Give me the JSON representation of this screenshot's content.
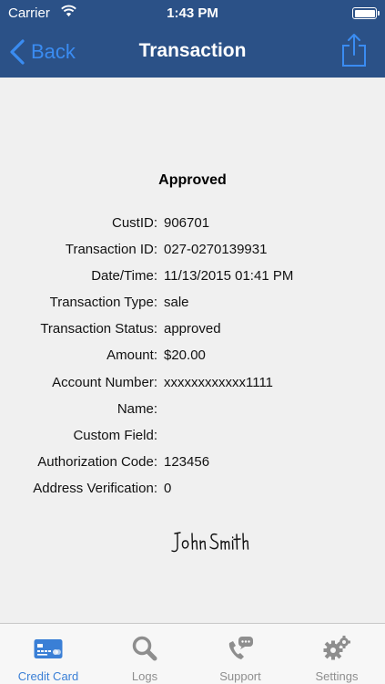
{
  "status_bar": {
    "carrier": "Carrier",
    "time": "1:43 PM"
  },
  "nav": {
    "back_label": "Back",
    "title": "Transaction"
  },
  "transaction": {
    "status": "Approved",
    "fields": [
      {
        "label": "CustID:",
        "value": "906701"
      },
      {
        "label": "Transaction ID:",
        "value": "027-0270139931"
      },
      {
        "label": "Date/Time:",
        "value": "11/13/2015 01:41 PM"
      },
      {
        "label": "Transaction Type:",
        "value": "sale"
      },
      {
        "label": "Transaction Status:",
        "value": "approved"
      },
      {
        "label": "Amount:",
        "value": "$20.00"
      },
      {
        "label": "Account Number:",
        "value": "xxxxxxxxxxxx1111"
      },
      {
        "label": "Name:",
        "value": ""
      },
      {
        "label": "Custom Field:",
        "value": ""
      },
      {
        "label": "Authorization Code:",
        "value": "123456"
      },
      {
        "label": "Address Verification:",
        "value": "0"
      }
    ],
    "signature": "John Smith"
  },
  "tabs": [
    {
      "label": "Credit Card",
      "icon": "credit-card-icon",
      "active": true
    },
    {
      "label": "Logs",
      "icon": "magnifier-icon",
      "active": false
    },
    {
      "label": "Support",
      "icon": "phone-chat-icon",
      "active": false
    },
    {
      "label": "Settings",
      "icon": "gears-icon",
      "active": false
    }
  ],
  "colors": {
    "nav_background": "#2b5187",
    "accent": "#3a8cf2",
    "tab_active": "#3a7fd6",
    "tab_inactive": "#8e8e8e"
  }
}
